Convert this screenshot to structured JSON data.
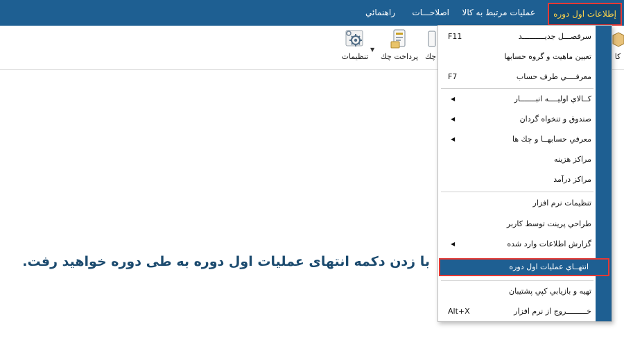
{
  "menubar": {
    "items": [
      {
        "label": "إطلاعات اول دوره"
      },
      {
        "label": "عمليات مرتبط به كالا"
      },
      {
        "label": "اصلاحـــات"
      },
      {
        "label": "راهنمائي"
      }
    ]
  },
  "toolbar": {
    "settings_label": "تنظيمات",
    "check_payment_label": "پرداخت چك",
    "check_partial_label": "چك",
    "partial_right_label": "كا"
  },
  "dropdown": {
    "items": [
      {
        "label": "سرفصـــل جديــــــــــد",
        "shortcut": "F11"
      },
      {
        "label": "تعيين ماهيت و گروه حسابها"
      },
      {
        "label": "معرفــــي طرف حساب",
        "shortcut": "F7"
      },
      {
        "label": "كــالاي اوليــــه انبـــــــار"
      },
      {
        "label": "صندوق و تنخواه گردان"
      },
      {
        "label": "معرفي حسابهــا و چك ها"
      },
      {
        "label": "مراكز هزينه"
      },
      {
        "label": "مراكز درآمد"
      },
      {
        "label": "تنظيمات نرم افزار"
      },
      {
        "label": "طراحي پرينت توسط كاربر"
      },
      {
        "label": "گزارش اطلاعات وارد شده"
      },
      {
        "label": "انتهــاي عمليات اول دوره"
      },
      {
        "label": "تهيه و بازيابي كپي پشتيبان"
      },
      {
        "label": "خـــــــــروج از نرم افزار",
        "shortcut": "Alt+X"
      }
    ],
    "submenu_glyph": "◀"
  },
  "caption": "با زدن دکمه انتهای عملیات اول دوره به طی دوره خواهید رفت.",
  "colors": {
    "menubar_bg": "#1e5f92",
    "active_text": "#ffd54a",
    "highlight_border": "#e53935",
    "caption_text": "#1b4a6e"
  },
  "icons": {
    "settings": "gear-icon",
    "check_payment": "check-card-icon",
    "box": "box-icon"
  }
}
